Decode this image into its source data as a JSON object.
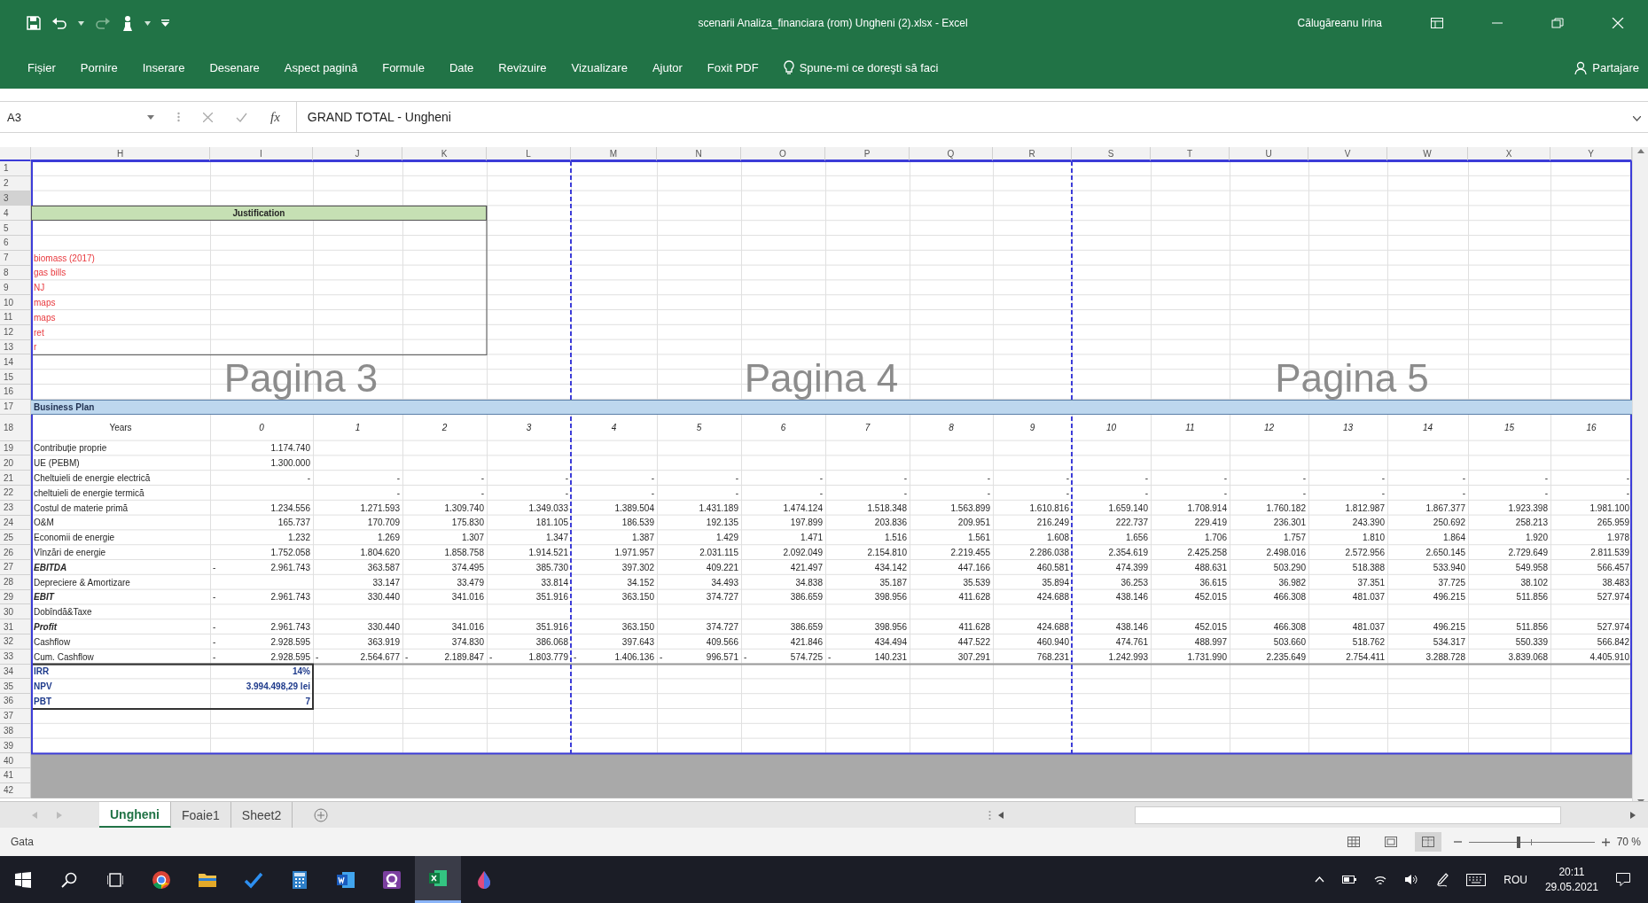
{
  "window": {
    "title": "scenarii Analiza_financiara (rom) Ungheni (2).xlsx  -  Excel",
    "user": "Călugăreanu Irina"
  },
  "ribbon": {
    "tabs": [
      {
        "label": "Fișier",
        "selected": false
      },
      {
        "label": "Pornire",
        "selected": false
      },
      {
        "label": "Inserare",
        "selected": false
      },
      {
        "label": "Desenare",
        "selected": false
      },
      {
        "label": "Aspect pagină",
        "selected": false
      },
      {
        "label": "Formule",
        "selected": false
      },
      {
        "label": "Date",
        "selected": false
      },
      {
        "label": "Revizuire",
        "selected": false
      },
      {
        "label": "Vizualizare",
        "selected": false
      },
      {
        "label": "Ajutor",
        "selected": false
      },
      {
        "label": "Foxit PDF",
        "selected": false
      }
    ],
    "tell_me": "Spune-mi ce doreşti să faci",
    "share": "Partajare"
  },
  "formula_bar": {
    "name_box": "A3",
    "function_label": "fx",
    "formula": "GRAND TOTAL - Ungheni"
  },
  "sheet": {
    "columns": [
      "H",
      "I",
      "J",
      "K",
      "L",
      "M",
      "N",
      "O",
      "P",
      "Q",
      "R",
      "S",
      "T",
      "U",
      "V",
      "W",
      "X",
      "Y"
    ],
    "row_numbers": [
      "1",
      "2",
      "3",
      "4",
      "5",
      "6",
      "7",
      "8",
      "9",
      "10",
      "11",
      "12",
      "13",
      "14",
      "15",
      "16",
      "17",
      "18",
      "19",
      "20",
      "21",
      "22",
      "23",
      "24",
      "25",
      "26",
      "27",
      "28",
      "29",
      "30",
      "31",
      "32",
      "33",
      "34",
      "35",
      "36",
      "37",
      "38",
      "39",
      "40",
      "41",
      "42"
    ],
    "justification": {
      "title": "Justification",
      "notes": [
        "biomass (2017)",
        "gas bills",
        "NJ",
        "maps",
        "maps",
        "ret",
        "r"
      ]
    },
    "section_title": "Business Plan",
    "years_label": "Years",
    "years": [
      "0",
      "1",
      "2",
      "3",
      "4",
      "5",
      "6",
      "7",
      "8",
      "9",
      "10",
      "11",
      "12",
      "13",
      "14",
      "15",
      "16"
    ],
    "rows": [
      {
        "label": "Contribuție proprie",
        "kind": "normal",
        "cells": [
          "1.174.740"
        ]
      },
      {
        "label": "UE (PEBM)",
        "kind": "normal",
        "cells": [
          "1.300.000"
        ]
      },
      {
        "label": "Cheltuieli de energie electrică",
        "kind": "normal",
        "cells": [
          "-",
          "-",
          "-",
          "-",
          "-",
          "-",
          "-",
          "-",
          "-",
          "-",
          "-",
          "-",
          "-",
          "-",
          "-",
          "-",
          "-"
        ]
      },
      {
        "label": "cheltuieli de energie termică",
        "kind": "normal",
        "cells": [
          null,
          "-",
          "-",
          "-",
          "-",
          "-",
          "-",
          "-",
          "-",
          "-",
          "-",
          "-",
          "-",
          "-",
          "-",
          "-",
          "-"
        ]
      },
      {
        "label": "Costul de materie primă",
        "kind": "normal",
        "cells": [
          "1.234.556",
          "1.271.593",
          "1.309.740",
          "1.349.033",
          "1.389.504",
          "1.431.189",
          "1.474.124",
          "1.518.348",
          "1.563.899",
          "1.610.816",
          "1.659.140",
          "1.708.914",
          "1.760.182",
          "1.812.987",
          "1.867.377",
          "1.923.398",
          "1.981.100"
        ]
      },
      {
        "label": "O&M",
        "kind": "normal",
        "cells": [
          "165.737",
          "170.709",
          "175.830",
          "181.105",
          "186.539",
          "192.135",
          "197.899",
          "203.836",
          "209.951",
          "216.249",
          "222.737",
          "229.419",
          "236.301",
          "243.390",
          "250.692",
          "258.213",
          "265.959"
        ]
      },
      {
        "label": "Economii de energie",
        "kind": "normal",
        "cells": [
          "1.232",
          "1.269",
          "1.307",
          "1.347",
          "1.387",
          "1.429",
          "1.471",
          "1.516",
          "1.561",
          "1.608",
          "1.656",
          "1.706",
          "1.757",
          "1.810",
          "1.864",
          "1.920",
          "1.978"
        ]
      },
      {
        "label": "Vînzări de energie",
        "kind": "normal",
        "cells": [
          "1.752.058",
          "1.804.620",
          "1.858.758",
          "1.914.521",
          "1.971.957",
          "2.031.115",
          "2.092.049",
          "2.154.810",
          "2.219.455",
          "2.286.038",
          "2.354.619",
          "2.425.258",
          "2.498.016",
          "2.572.956",
          "2.650.145",
          "2.729.649",
          "2.811.539"
        ]
      },
      {
        "label": "EBITDA",
        "kind": "bold-italic",
        "cells": [
          {
            "sign": "-",
            "value": "2.961.743"
          },
          "363.587",
          "374.495",
          "385.730",
          "397.302",
          "409.221",
          "421.497",
          "434.142",
          "447.166",
          "460.581",
          "474.399",
          "488.631",
          "503.290",
          "518.388",
          "533.940",
          "549.958",
          "566.457"
        ]
      },
      {
        "label": "Depreciere & Amortizare",
        "kind": "normal",
        "cells": [
          null,
          "33.147",
          "33.479",
          "33.814",
          "34.152",
          "34.493",
          "34.838",
          "35.187",
          "35.539",
          "35.894",
          "36.253",
          "36.615",
          "36.982",
          "37.351",
          "37.725",
          "38.102",
          "38.483"
        ]
      },
      {
        "label": "EBIT",
        "kind": "bold-italic",
        "cells": [
          {
            "sign": "-",
            "value": "2.961.743"
          },
          "330.440",
          "341.016",
          "351.916",
          "363.150",
          "374.727",
          "386.659",
          "398.956",
          "411.628",
          "424.688",
          "438.146",
          "452.015",
          "466.308",
          "481.037",
          "496.215",
          "511.856",
          "527.974"
        ]
      },
      {
        "label": "Dobîndă&Taxe",
        "kind": "normal"
      },
      {
        "label": "Profit",
        "kind": "bold-italic",
        "cells": [
          {
            "sign": "-",
            "value": "2.961.743"
          },
          "330.440",
          "341.016",
          "351.916",
          "363.150",
          "374.727",
          "386.659",
          "398.956",
          "411.628",
          "424.688",
          "438.146",
          "452.015",
          "466.308",
          "481.037",
          "496.215",
          "511.856",
          "527.974"
        ]
      },
      {
        "label": "Cashflow",
        "kind": "normal",
        "cells": [
          {
            "sign": "-",
            "value": "2.928.595"
          },
          "363.919",
          "374.830",
          "386.068",
          "397.643",
          "409.566",
          "421.846",
          "434.494",
          "447.522",
          "460.940",
          "474.761",
          "488.997",
          "503.660",
          "518.762",
          "534.317",
          "550.339",
          "566.842"
        ]
      },
      {
        "label": "Cum. Cashflow",
        "kind": "normal",
        "cells": [
          {
            "sign": "-",
            "value": "2.928.595"
          },
          {
            "sign": "-",
            "value": "2.564.677"
          },
          {
            "sign": "-",
            "value": "2.189.847"
          },
          {
            "sign": "-",
            "value": "1.803.779"
          },
          {
            "sign": "-",
            "value": "1.406.136"
          },
          {
            "sign": "-",
            "value": "996.571"
          },
          {
            "sign": "-",
            "value": "574.725"
          },
          {
            "sign": "-",
            "value": "140.231"
          },
          "307.291",
          "768.231",
          "1.242.993",
          "1.731.990",
          "2.235.649",
          "2.754.411",
          "3.288.728",
          "3.839.068",
          "4.405.910"
        ]
      }
    ],
    "metrics": [
      {
        "label": "IRR",
        "value": "14%"
      },
      {
        "label": "NPV",
        "value": "3.994.498,29 lei"
      },
      {
        "label": "PBT",
        "value": "7"
      }
    ],
    "page_labels": [
      "Pagina 3",
      "Pagina 4",
      "Pagina 5"
    ]
  },
  "sheet_tabs": [
    {
      "label": "Ungheni",
      "selected": true
    },
    {
      "label": "Foaie1",
      "selected": false
    },
    {
      "label": "Sheet2",
      "selected": false
    }
  ],
  "status_bar": {
    "status": "Gata",
    "views": [
      {
        "selected": false
      },
      {
        "selected": false
      },
      {
        "selected": true
      }
    ],
    "zoom": {
      "level": 0.4,
      "reading": "70 %"
    }
  },
  "taskbar": {
    "apps": [
      {
        "selected": false
      },
      {
        "selected": false
      },
      {
        "selected": false
      },
      {
        "selected": false
      },
      {
        "selected": false
      },
      {
        "selected": false
      },
      {
        "selected": true
      },
      {
        "selected": false
      }
    ],
    "language": "ROU",
    "time": "20:11",
    "date": "29.05.2021"
  }
}
